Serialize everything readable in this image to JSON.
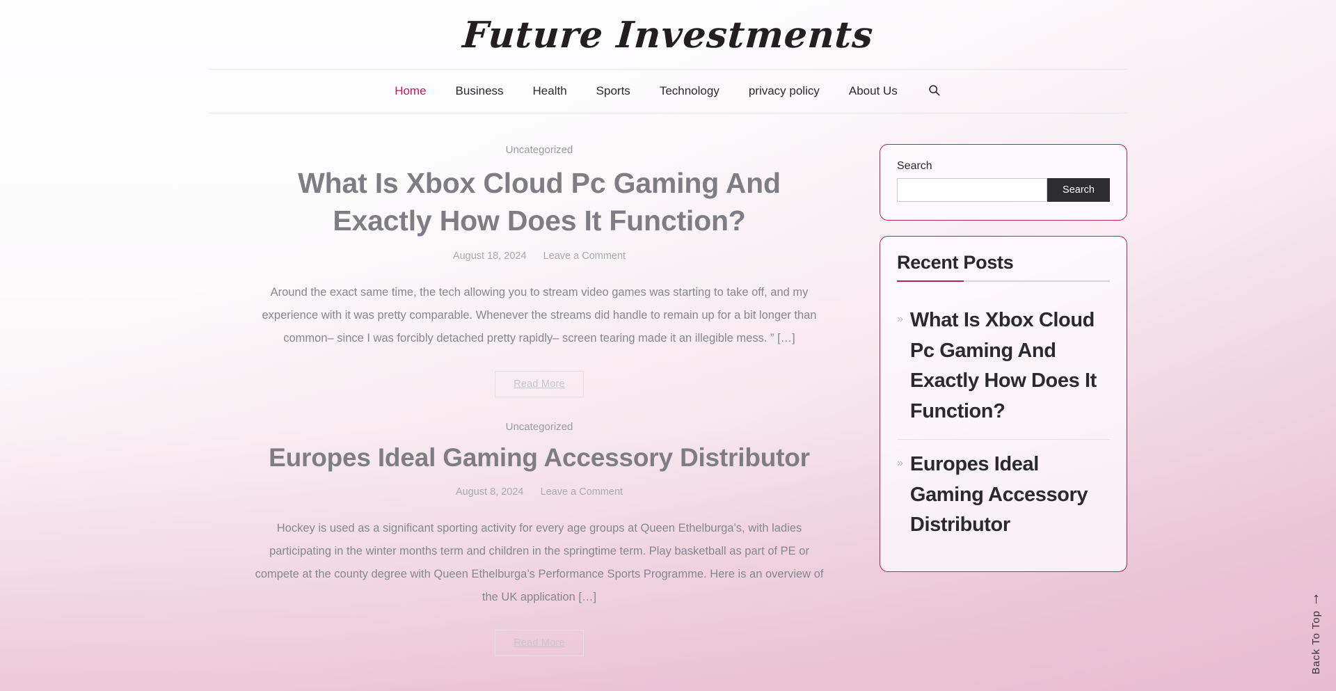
{
  "site": {
    "title": "Future Investments",
    "accent_color": "#b3245e",
    "nav_active_color": "#c2185b"
  },
  "nav": {
    "items": [
      {
        "label": "Home",
        "active": true
      },
      {
        "label": "Business",
        "active": false
      },
      {
        "label": "Health",
        "active": false
      },
      {
        "label": "Sports",
        "active": false
      },
      {
        "label": "Technology",
        "active": false
      },
      {
        "label": "privacy policy",
        "active": false
      },
      {
        "label": "About Us",
        "active": false
      }
    ],
    "search_icon": "search-icon"
  },
  "posts": [
    {
      "category": "Uncategorized",
      "title": "What Is Xbox Cloud Pc Gaming And Exactly How Does It Function?",
      "date": "August 18, 2024",
      "comment_link": "Leave a Comment",
      "excerpt": "Around the exact same time, the tech allowing you to stream video games was starting to take off, and my experience with it was pretty comparable. Whenever the streams did handle to remain up for a bit longer than common– since I was forcibly detached pretty rapidly– screen tearing made it an illegible mess. ” […]",
      "read_more": "Read More"
    },
    {
      "category": "Uncategorized",
      "title": "Europes Ideal Gaming Accessory Distributor",
      "date": "August 8, 2024",
      "comment_link": "Leave a Comment",
      "excerpt": "Hockey is used as a significant sporting activity for every age groups at Queen Ethelburga’s, with ladies participating in the winter months term and children in the springtime term. Play basketball as part of PE or compete at the county degree with Queen Ethelburga’s Performance Sports Programme. Here is an overview of the UK application […]",
      "read_more": "Read More"
    }
  ],
  "sidebar": {
    "search_widget": {
      "label": "Search",
      "input_value": "",
      "input_placeholder": "",
      "button_label": "Search"
    },
    "recent_posts_widget": {
      "title": "Recent Posts",
      "bullet": "»",
      "items": [
        {
          "label": "What Is Xbox Cloud Pc Gaming And Exactly How Does It Function?"
        },
        {
          "label": "Europes Ideal Gaming Accessory Distributor"
        }
      ]
    }
  },
  "back_to_top": {
    "label": "Back To Top",
    "arrow": "↑"
  }
}
